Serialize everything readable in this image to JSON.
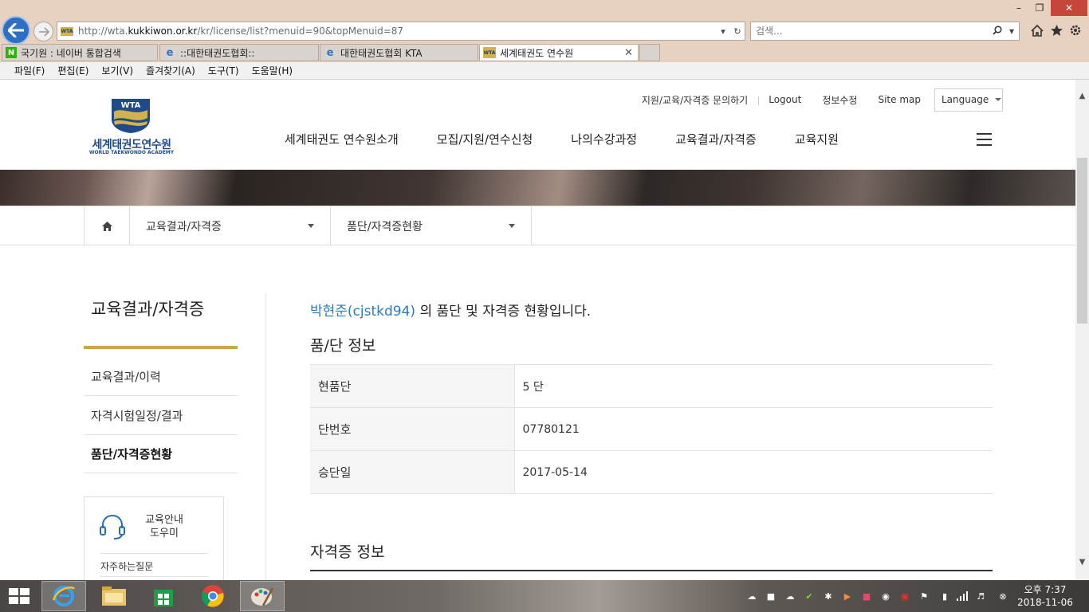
{
  "browser": {
    "url_prefix": "http://wta.",
    "url_domain": "kukkiwon.or.kr",
    "url_path": "/kr/license/list?menuid=90&topMenuid=87",
    "search_placeholder": "검색...",
    "tabs": [
      {
        "label": "국기원 : 네이버 통합검색",
        "icon": "naver-icon"
      },
      {
        "label": "::대한태권도협회::",
        "icon": "ie-icon"
      },
      {
        "label": "대한태권도협회 KTA",
        "icon": "ie-icon"
      },
      {
        "label": "세계태권도 연수원",
        "icon": "wta-icon",
        "active": true
      }
    ],
    "menu": [
      "파일(F)",
      "편집(E)",
      "보기(V)",
      "즐겨찾기(A)",
      "도구(T)",
      "도움말(H)"
    ]
  },
  "site": {
    "logo_badge": "WTA",
    "logo_kname": "세계태권도연수원",
    "logo_ename": "WORLD TAEKWONDO ACADEMY",
    "util_links": [
      "지원/교육/자격증 문의하기",
      "Logout",
      "정보수정",
      "Site map"
    ],
    "language_label": "Language",
    "gnb": [
      "세계태권도 연수원소개",
      "모집/지원/연수신청",
      "나의수강과정",
      "교육결과/자격증",
      "교육지원"
    ]
  },
  "crumb": {
    "level1": "교육결과/자격증",
    "level2": "품단/자격증현황"
  },
  "lnb": {
    "title": "교육결과/자격증",
    "items": [
      "교육결과/이력",
      "자격시험일정/결과",
      "품단/자격증현황"
    ],
    "helper_title_1": "교육안내",
    "helper_title_2": "도우미",
    "helper_faq": "자주하는질문"
  },
  "main": {
    "user_name": "박현준(cjstkd94)",
    "greeting_rest": " 의 품단 및 자격증 현황입니다.",
    "section1_title": "품/단 정보",
    "rows": [
      {
        "label": "현품단",
        "value": "5 단"
      },
      {
        "label": "단번호",
        "value": "07780121"
      },
      {
        "label": "승단일",
        "value": "2017-05-14"
      }
    ],
    "section2_title": "자격증 정보"
  },
  "taskbar": {
    "clock_time": "오후 7:37",
    "clock_date": "2018-11-06"
  },
  "colors": {
    "accent_gold": "#c7a84a",
    "link_blue": "#2c7bbf",
    "logo_blue": "#1f4b8c"
  }
}
